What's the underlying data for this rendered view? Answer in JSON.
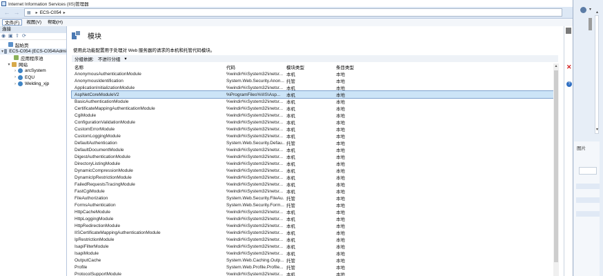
{
  "window": {
    "title": "Internet Information Services (IIS)管理器"
  },
  "address": {
    "path": [
      "ECS-C054"
    ]
  },
  "menu": [
    "文件(F)",
    "视图(V)",
    "帮助(H)"
  ],
  "connections": {
    "title": "连接",
    "tree": [
      {
        "label": "起始页",
        "level": 1,
        "icon": "home-icon"
      },
      {
        "label": "ECS-C054 (ECS-C054\\Admi",
        "level": 0,
        "icon": "server-icon",
        "expanded": true
      },
      {
        "label": "应用程序池",
        "level": 1,
        "icon": "app-pool-icon"
      },
      {
        "label": "网站",
        "level": 1,
        "icon": "sites-folder-icon",
        "expanded": true
      },
      {
        "label": "arcSystem",
        "level": 2,
        "icon": "globe-icon"
      },
      {
        "label": "EQU",
        "level": 2,
        "icon": "globe-icon"
      },
      {
        "label": "Welding_xjp",
        "level": 2,
        "icon": "globe-icon"
      }
    ]
  },
  "main": {
    "title": "模块",
    "description": "使用此功能配置用于处理对 Web 服务器的请求的本机和托管代码模块。",
    "group_label": "分组依据:",
    "group_value": "不进行分组",
    "columns": {
      "name": "名称",
      "code": "代码",
      "type": "模块类型",
      "entry": "条目类型"
    },
    "rows": [
      {
        "name": "AnonymousAuthenticationModule",
        "code": "%windir%\\System32\\inetsr...",
        "type": "本机",
        "entry": "本地"
      },
      {
        "name": "AnonymousIdentification",
        "code": "System.Web.Security.Anon...",
        "type": "托管",
        "entry": "本地"
      },
      {
        "name": "ApplicationInitializationModule",
        "code": "%windir%\\System32\\inetsr...",
        "type": "本机",
        "entry": "本地"
      },
      {
        "name": "AspNetCoreModuleV2",
        "code": "%ProgramFiles%\\IIS\\Asp...",
        "type": "本机",
        "entry": "本地",
        "selected": true
      },
      {
        "name": "BasicAuthenticationModule",
        "code": "%windir%\\System32\\inetsr...",
        "type": "本机",
        "entry": "本地"
      },
      {
        "name": "CertificateMappingAuthenticationModule",
        "code": "%windir%\\System32\\inetsr...",
        "type": "本机",
        "entry": "本地"
      },
      {
        "name": "CgiModule",
        "code": "%windir%\\System32\\inetsr...",
        "type": "本机",
        "entry": "本地"
      },
      {
        "name": "ConfigurationValidationModule",
        "code": "%windir%\\System32\\inetsr...",
        "type": "本机",
        "entry": "本地"
      },
      {
        "name": "CustomErrorModule",
        "code": "%windir%\\System32\\inetsr...",
        "type": "本机",
        "entry": "本地"
      },
      {
        "name": "CustomLoggingModule",
        "code": "%windir%\\System32\\inetsr...",
        "type": "本机",
        "entry": "本地"
      },
      {
        "name": "DefaultAuthentication",
        "code": "System.Web.Security.Defau...",
        "type": "托管",
        "entry": "本地"
      },
      {
        "name": "DefaultDocumentModule",
        "code": "%windir%\\System32\\inetsr...",
        "type": "本机",
        "entry": "本地"
      },
      {
        "name": "DigestAuthenticationModule",
        "code": "%windir%\\System32\\inetsr...",
        "type": "本机",
        "entry": "本地"
      },
      {
        "name": "DirectoryListingModule",
        "code": "%windir%\\System32\\inetsr...",
        "type": "本机",
        "entry": "本地"
      },
      {
        "name": "DynamicCompressionModule",
        "code": "%windir%\\System32\\inetsr...",
        "type": "本机",
        "entry": "本地"
      },
      {
        "name": "DynamicIpRestrictionModule",
        "code": "%windir%\\System32\\inetsr...",
        "type": "本机",
        "entry": "本地"
      },
      {
        "name": "FailedRequestsTracingModule",
        "code": "%windir%\\System32\\inetsr...",
        "type": "本机",
        "entry": "本地"
      },
      {
        "name": "FastCgiModule",
        "code": "%windir%\\System32\\inetsr...",
        "type": "本机",
        "entry": "本地"
      },
      {
        "name": "FileAuthorization",
        "code": "System.Web.Security.FileAu...",
        "type": "托管",
        "entry": "本地"
      },
      {
        "name": "FormsAuthentication",
        "code": "System.Web.Security.Form...",
        "type": "托管",
        "entry": "本地"
      },
      {
        "name": "HttpCacheModule",
        "code": "%windir%\\System32\\inetsr...",
        "type": "本机",
        "entry": "本地"
      },
      {
        "name": "HttpLoggingModule",
        "code": "%windir%\\System32\\inetsr...",
        "type": "本机",
        "entry": "本地"
      },
      {
        "name": "HttpRedirectionModule",
        "code": "%windir%\\System32\\inetsr...",
        "type": "本机",
        "entry": "本地"
      },
      {
        "name": "IISCertificateMappingAuthenticationModule",
        "code": "%windir%\\System32\\inetsr...",
        "type": "本机",
        "entry": "本地"
      },
      {
        "name": "IpRestrictionModule",
        "code": "%windir%\\System32\\inetsr...",
        "type": "本机",
        "entry": "本地"
      },
      {
        "name": "IsapiFilterModule",
        "code": "%windir%\\System32\\inetsr...",
        "type": "本机",
        "entry": "本地"
      },
      {
        "name": "IsapiModule",
        "code": "%windir%\\System32\\inetsr...",
        "type": "本机",
        "entry": "本地"
      },
      {
        "name": "OutputCache",
        "code": "System.Web.Caching.Outp...",
        "type": "托管",
        "entry": "本地"
      },
      {
        "name": "Profile",
        "code": "System.Web.Profile.Profile...",
        "type": "托管",
        "entry": "本地"
      },
      {
        "name": "ProtocolSupportModule",
        "code": "%windir%\\System32\\inetsr...",
        "type": "本机",
        "entry": "本地"
      }
    ]
  },
  "side_panel": {
    "label": "图片"
  }
}
